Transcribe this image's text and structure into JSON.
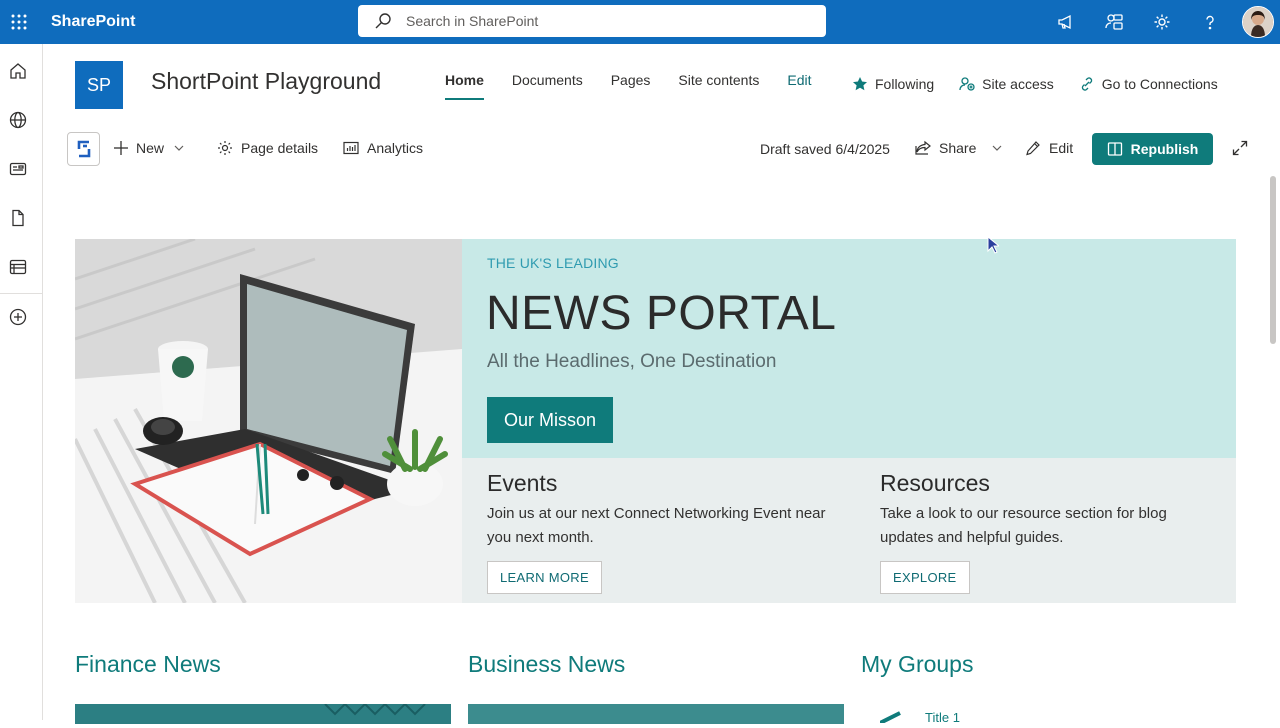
{
  "suite": {
    "app_name": "SharePoint",
    "search_placeholder": "Search in SharePoint"
  },
  "site": {
    "logo_text": "SP",
    "title": "ShortPoint Playground",
    "nav": [
      {
        "label": "Home",
        "active": true
      },
      {
        "label": "Documents"
      },
      {
        "label": "Pages"
      },
      {
        "label": "Site contents"
      },
      {
        "label": "Edit"
      }
    ],
    "actions": {
      "following": "Following",
      "site_access": "Site access",
      "connections": "Go to Connections"
    }
  },
  "commandbar": {
    "new": "New",
    "page_details": "Page details",
    "analytics": "Analytics",
    "draft_status": "Draft saved 6/4/2025",
    "share": "Share",
    "edit": "Edit",
    "republish": "Republish"
  },
  "hero": {
    "eyebrow": "THE UK'S LEADING",
    "title": "NEWS PORTAL",
    "subtitle": "All the Headlines, One Destination",
    "cta": "Our Misson",
    "events": {
      "title": "Events",
      "text": "Join us at our next Connect Networking Event near you next month.",
      "button": "LEARN MORE"
    },
    "resources": {
      "title": "Resources",
      "text": "Take a look to our resource section for blog updates and helpful guides.",
      "button": "EXPLORE"
    }
  },
  "sections": {
    "finance": "Finance News",
    "business": "Business News",
    "groups": "My Groups",
    "group_item_1": "Title 1"
  },
  "colors": {
    "suite_blue": "#0f6cbd",
    "teal": "#0f7b7b",
    "banner_bg": "#c8e9e7",
    "lower_bg": "#e9eeee"
  },
  "icons": [
    "waffle-icon",
    "search-icon",
    "megaphone-icon",
    "share-people-icon",
    "gear-icon",
    "help-icon",
    "home-icon",
    "globe-icon",
    "news-icon",
    "page-icon",
    "list-icon",
    "add-circle-icon",
    "star-icon",
    "site-access-icon",
    "connections-icon",
    "plus-icon",
    "chevron-down-icon",
    "analytics-icon",
    "share-icon",
    "pencil-icon",
    "republish-icon",
    "expand-icon"
  ]
}
